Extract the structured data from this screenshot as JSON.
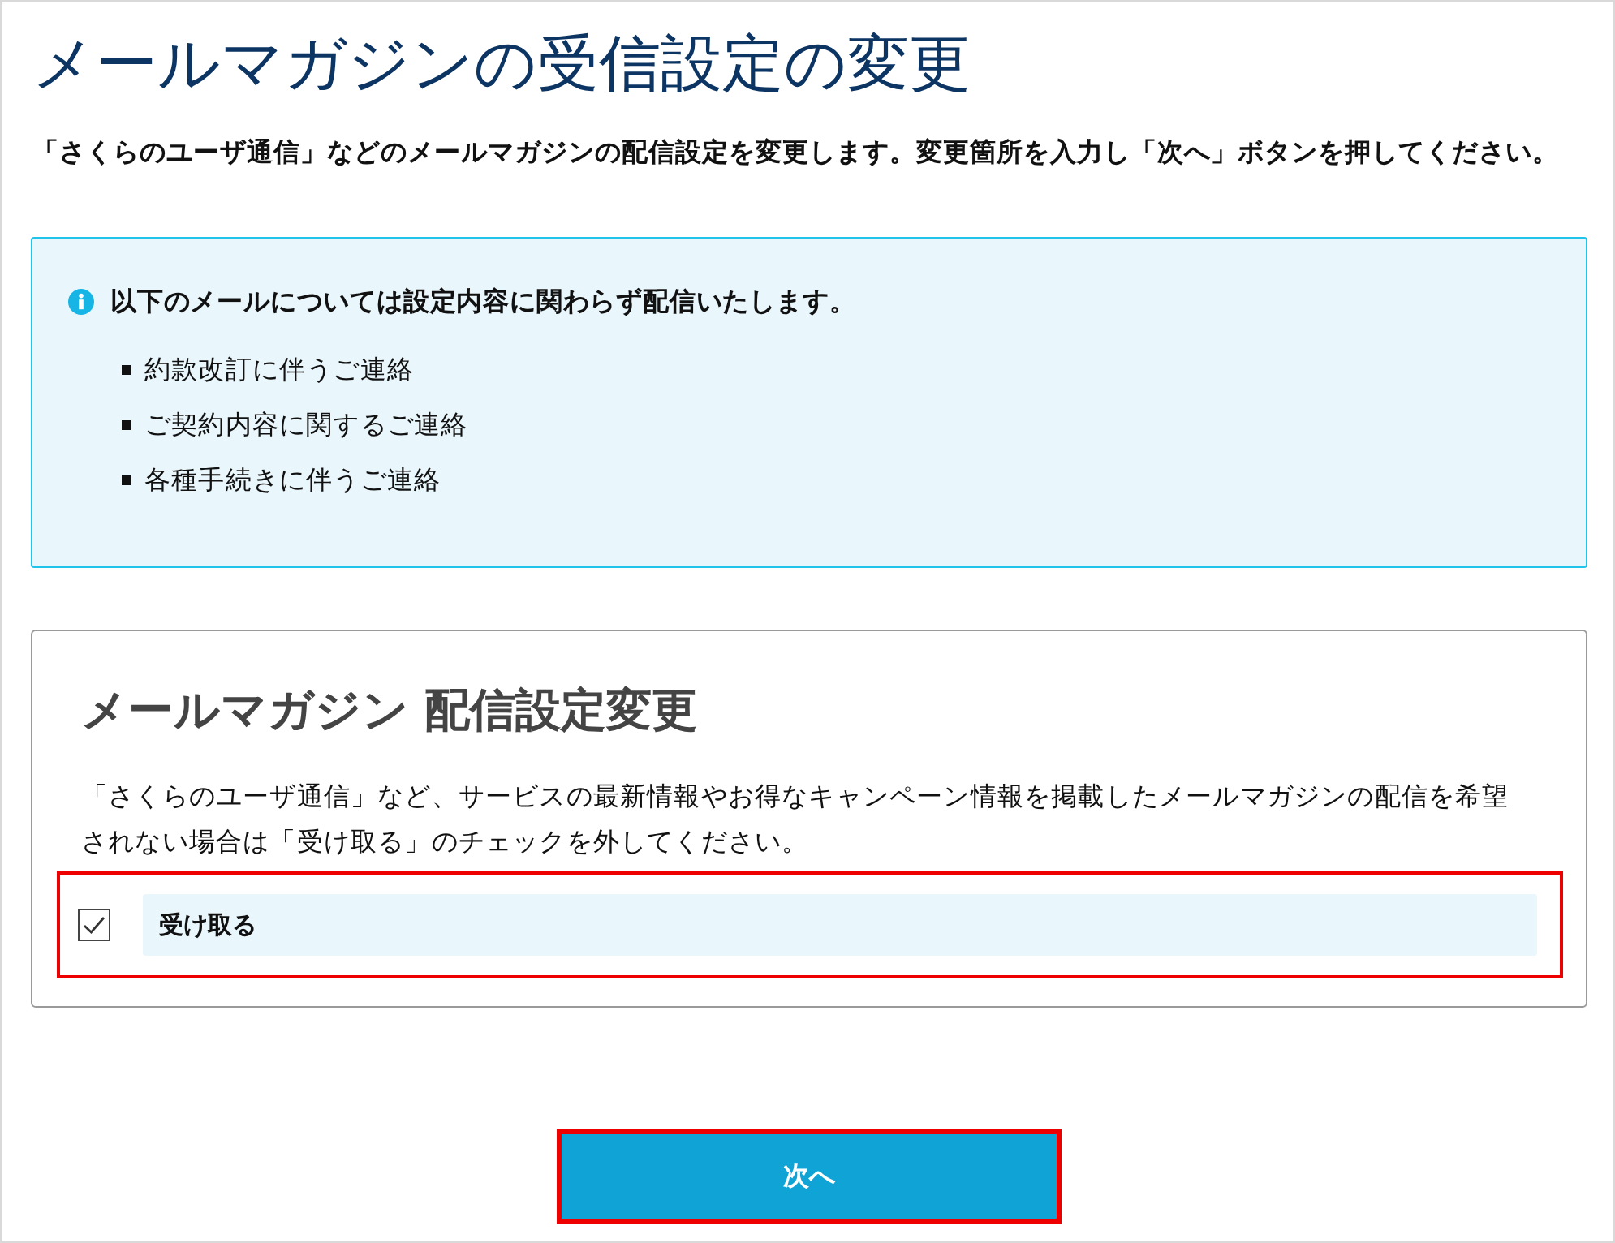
{
  "page_title": "メールマガジンの受信設定の変更",
  "intro": "「さくらのユーザ通信」などのメールマガジンの配信設定を変更します。変更箇所を入力し「次へ」ボタンを押してください。",
  "notice": {
    "heading": "以下のメールについては設定内容に関わらず配信いたします。",
    "items": [
      "約款改訂に伴うご連絡",
      "ご契約内容に関するご連絡",
      "各種手続きに伴うご連絡"
    ]
  },
  "settings": {
    "title": "メールマガジン 配信設定変更",
    "description": "「さくらのユーザ通信」など、サービスの最新情報やお得なキャンペーン情報を掲載したメールマガジンの配信を希望されない場合は「受け取る」のチェックを外してください。",
    "option": {
      "label": "受け取る",
      "checked": true,
      "highlighted": true
    }
  },
  "next_button": {
    "label": "次へ",
    "highlighted": true
  }
}
